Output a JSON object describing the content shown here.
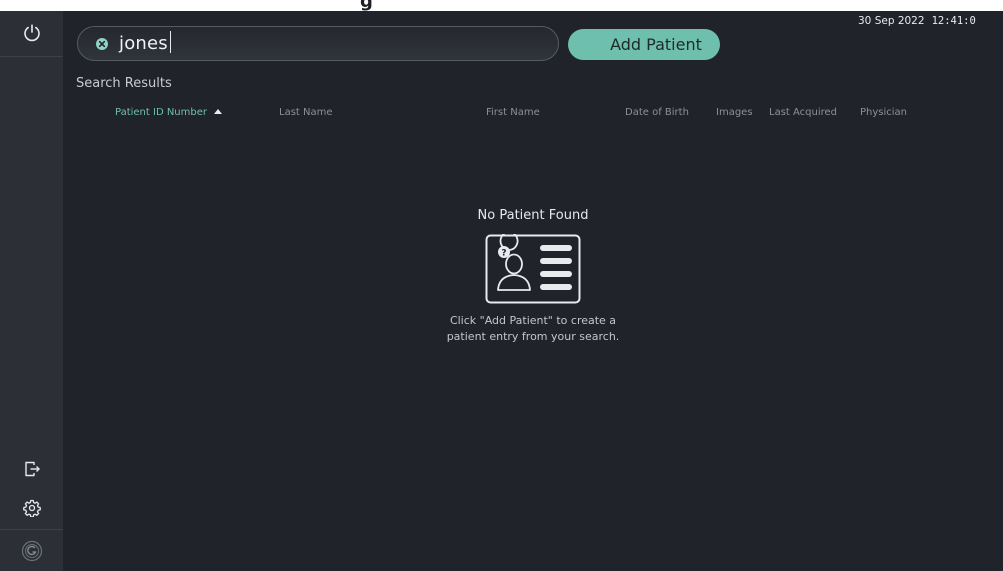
{
  "header": {
    "cropped_title": "g"
  },
  "sidebar": {
    "top": {
      "icon": "power-icon"
    },
    "bottom": [
      {
        "icon": "logout-icon"
      },
      {
        "icon": "gear-icon"
      },
      {
        "icon": "app-logo-icon"
      }
    ]
  },
  "search": {
    "value": "jones",
    "clear_icon": "clear-icon"
  },
  "actions": {
    "add_patient_label": "Add Patient"
  },
  "status": {
    "date": "30 Sep 2022",
    "time": "12:41:0"
  },
  "results": {
    "title": "Search Results",
    "columns": [
      {
        "label": "Patient ID Number",
        "sorted": "ascending"
      },
      {
        "label": "Last Name"
      },
      {
        "label": "First Name"
      },
      {
        "label": "Date of Birth"
      },
      {
        "label": "Images"
      },
      {
        "label": "Last Acquired"
      },
      {
        "label": "Physician"
      }
    ],
    "rows": [],
    "empty": {
      "title": "No Patient Found",
      "illustration_icon": "patient-card-icon",
      "hint": "Click \"Add Patient\" to create a patient entry from your search."
    }
  },
  "colors": {
    "background": "#202329",
    "sidebar": "#2c2f35",
    "accent": "#6fbfae"
  }
}
